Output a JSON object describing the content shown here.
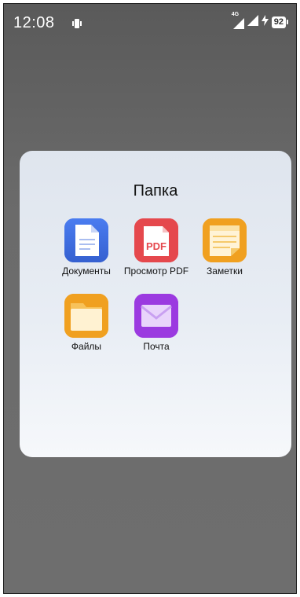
{
  "status_bar": {
    "time": "12:08",
    "network": "4G",
    "battery": "92"
  },
  "folder": {
    "title": "Папка",
    "apps": [
      {
        "label": "Документы",
        "icon": "docs-icon",
        "color": "#3f6fe0"
      },
      {
        "label": "Просмотр PDF",
        "icon": "pdf-icon",
        "color": "#e5484d"
      },
      {
        "label": "Заметки",
        "icon": "notes-icon",
        "color": "#f0a020"
      },
      {
        "label": "Файлы",
        "icon": "files-icon",
        "color": "#f0a020"
      },
      {
        "label": "Почта",
        "icon": "mail-icon",
        "color": "#9b3ae0"
      }
    ]
  },
  "pdf_icon_text": "PDF"
}
